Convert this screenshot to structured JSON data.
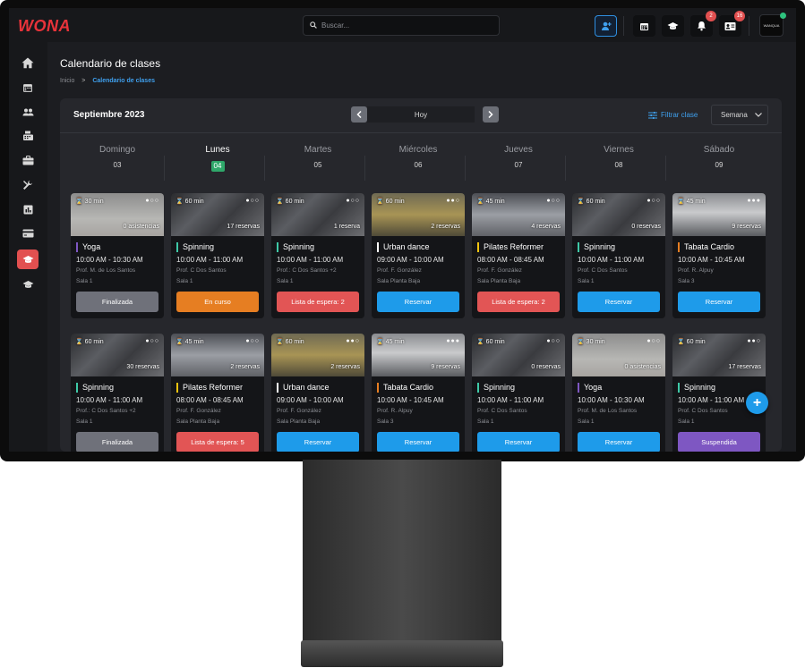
{
  "app": {
    "logo": "WONA"
  },
  "search": {
    "placeholder": "Buscar..."
  },
  "topbar": {
    "notifications_count": "2",
    "messages_count": "16",
    "user_name": "WANQUA"
  },
  "page": {
    "title": "Calendario de clases",
    "breadcrumb": [
      "Inicio",
      "Calendario de clases"
    ]
  },
  "calendar": {
    "month": "Septiembre 2023",
    "today_label": "Hoy",
    "filter_label": "Filtrar clase",
    "view_label": "Semana",
    "days": [
      {
        "name": "Domingo",
        "num": "03"
      },
      {
        "name": "Lunes",
        "num": "04"
      },
      {
        "name": "Martes",
        "num": "05"
      },
      {
        "name": "Miércoles",
        "num": "06"
      },
      {
        "name": "Jueves",
        "num": "07"
      },
      {
        "name": "Viernes",
        "num": "08"
      },
      {
        "name": "Sábado",
        "num": "09"
      }
    ]
  },
  "colors": {
    "accent_blue": "#1e9bea",
    "today_green": "#2fa86a",
    "danger_red": "#e25555",
    "orange": "#e67e22",
    "purple": "#7e57c2"
  },
  "classes": [
    {
      "duration": "30 min",
      "levels": "●○○",
      "count": "0 asistencias",
      "name": "Yoga",
      "time": "10:00 AM - 10:30 AM",
      "teacher": "Prof. M. de Los Santos",
      "room": "Sala 1",
      "button": "Finalizada",
      "btn_style": "b-fin",
      "img": "img-yoga",
      "bar": "#7e57c2"
    },
    {
      "duration": "60 min",
      "levels": "●○○",
      "count": "17 reservas",
      "name": "Spinning",
      "time": "10:00 AM - 11:00 AM",
      "teacher": "Prof. C Dos Santos",
      "room": "Sala 1",
      "button": "En curso",
      "btn_style": "b-curso",
      "img": "img-gym",
      "bar": "#3ec9a7"
    },
    {
      "duration": "60 min",
      "levels": "●○○",
      "count": "1 reserva",
      "name": "Spinning",
      "time": "10:00 AM - 11:00 AM",
      "teacher": "Prof.: C Dos Santos +2",
      "room": "Sala 1",
      "button": "Lista de espera: 2",
      "btn_style": "b-espera",
      "img": "img-gym",
      "bar": "#3ec9a7"
    },
    {
      "duration": "60 min",
      "levels": "●●○",
      "count": "2 reservas",
      "name": "Urban dance",
      "time": "09:00 AM - 10:00 AM",
      "teacher": "Prof. F. González",
      "room": "Sala Planta Baja",
      "button": "Reservar",
      "btn_style": "b-res",
      "img": "img-dance",
      "bar": "#ffffff"
    },
    {
      "duration": "45 min",
      "levels": "●○○",
      "count": "4 reservas",
      "name": "Pilates Reformer",
      "time": "08:00 AM - 08:45 AM",
      "teacher": "Prof. F. González",
      "room": "Sala Planta Baja",
      "button": "Lista de espera: 2",
      "btn_style": "b-espera",
      "img": "img-pil",
      "bar": "#f1c40f"
    },
    {
      "duration": "60 min",
      "levels": "●○○",
      "count": "0 reservas",
      "name": "Spinning",
      "time": "10:00 AM - 11:00 AM",
      "teacher": "Prof. C Dos Santos",
      "room": "Sala 1",
      "button": "Reservar",
      "btn_style": "b-res",
      "img": "img-gym",
      "bar": "#3ec9a7"
    },
    {
      "duration": "45 min",
      "levels": "●●●",
      "count": "9 reservas",
      "name": "Tabata Cardio",
      "time": "10:00 AM - 10:45 AM",
      "teacher": "Prof. R. Alpuy",
      "room": "Sala 3",
      "button": "Reservar",
      "btn_style": "b-res",
      "img": "img-tab",
      "bar": "#e67e22"
    },
    {
      "duration": "60 min",
      "levels": "●○○",
      "count": "30 reservas",
      "name": "Spinning",
      "time": "10:00 AM - 11:00 AM",
      "teacher": "Prof.: C Dos Santos +2",
      "room": "Sala 1",
      "button": "Finalizada",
      "btn_style": "b-fin",
      "img": "img-gym",
      "bar": "#3ec9a7"
    },
    {
      "duration": "45 min",
      "levels": "●○○",
      "count": "2 reservas",
      "name": "Pilates Reformer",
      "time": "08:00 AM - 08:45 AM",
      "teacher": "Prof. F. González",
      "room": "Sala Planta Baja",
      "button": "Lista de espera: 5",
      "btn_style": "b-espera",
      "img": "img-pil",
      "bar": "#f1c40f"
    },
    {
      "duration": "60 min",
      "levels": "●●○",
      "count": "2 reservas",
      "name": "Urban dance",
      "time": "09:00 AM - 10:00 AM",
      "teacher": "Prof. F. González",
      "room": "Sala Planta Baja",
      "button": "Reservar",
      "btn_style": "b-res",
      "img": "img-dance",
      "bar": "#ffffff"
    },
    {
      "duration": "45 min",
      "levels": "●●●",
      "count": "9 reservas",
      "name": "Tabata Cardio",
      "time": "10:00 AM - 10:45 AM",
      "teacher": "Prof. R. Alpuy",
      "room": "Sala 3",
      "button": "Reservar",
      "btn_style": "b-res",
      "img": "img-tab",
      "bar": "#e67e22"
    },
    {
      "duration": "60 min",
      "levels": "●○○",
      "count": "0 reservas",
      "name": "Spinning",
      "time": "10:00 AM - 11:00 AM",
      "teacher": "Prof. C Dos Santos",
      "room": "Sala 1",
      "button": "Reservar",
      "btn_style": "b-res",
      "img": "img-gym",
      "bar": "#3ec9a7"
    },
    {
      "duration": "30 min",
      "levels": "●○○",
      "count": "0 asistencias",
      "name": "Yoga",
      "time": "10:00 AM - 10:30 AM",
      "teacher": "Prof. M. de Los Santos",
      "room": "Sala 1",
      "button": "Reservar",
      "btn_style": "b-res",
      "img": "img-yoga",
      "bar": "#7e57c2"
    },
    {
      "duration": "60 min",
      "levels": "●●○",
      "count": "17 reservas",
      "name": "Spinning",
      "time": "10:00 AM - 11:00 AM",
      "teacher": "Prof. C Dos Santos",
      "room": "Sala 1",
      "button": "Suspendida",
      "btn_style": "b-susp",
      "img": "img-gym",
      "bar": "#3ec9a7"
    }
  ]
}
